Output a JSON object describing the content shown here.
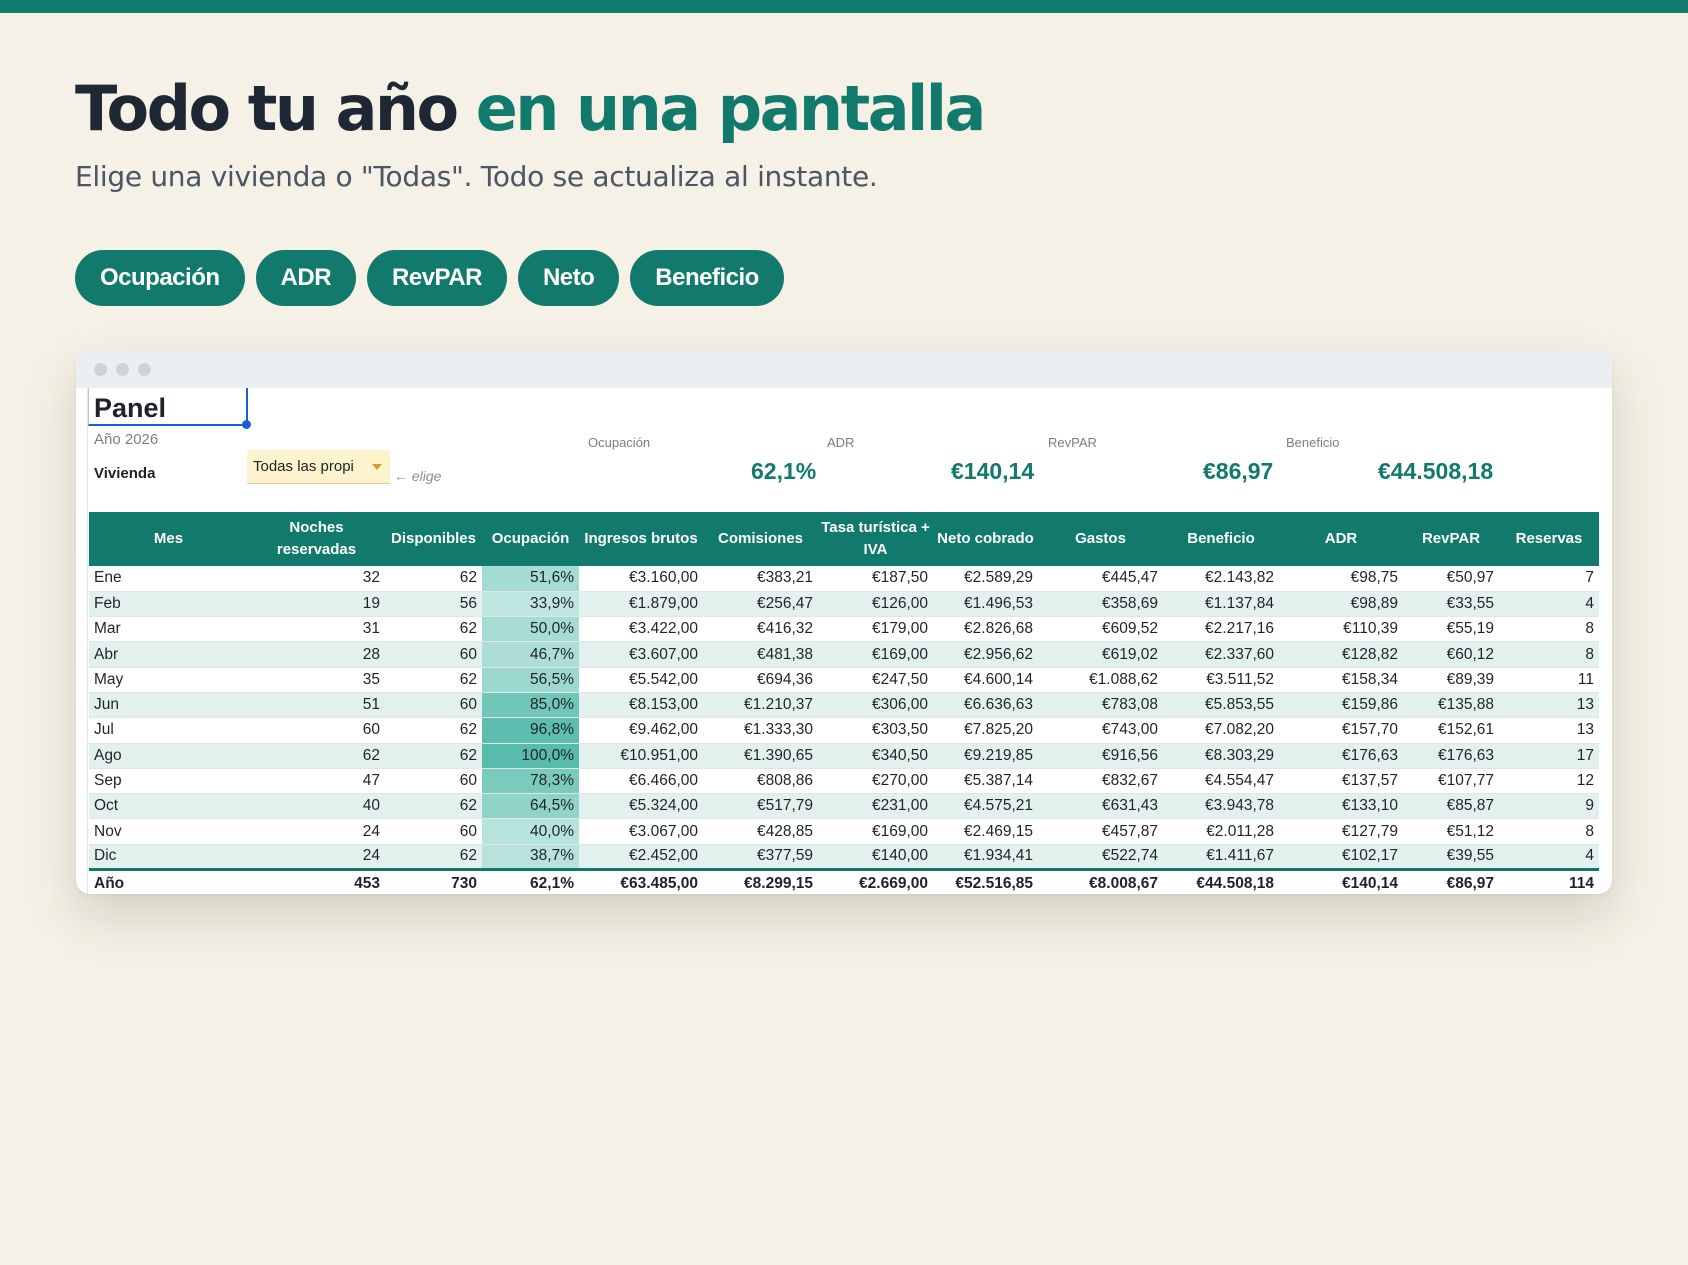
{
  "hero": {
    "title_main": "Todo tu año ",
    "title_accent": "en una pantalla",
    "subtitle": "Elige una vivienda o \"Todas\". Todo se actualiza al instante."
  },
  "pills": [
    "Ocupación",
    "ADR",
    "RevPAR",
    "Neto",
    "Beneficio"
  ],
  "sheet": {
    "panel_title": "Panel",
    "year": "Año 2026",
    "vivienda_label": "Vivienda",
    "vivienda_value": "Todas las propi",
    "elige_hint": "← elige",
    "kpis": [
      {
        "label": "Ocupación",
        "value": "62,1%"
      },
      {
        "label": "ADR",
        "value": "€140,14"
      },
      {
        "label": "RevPAR",
        "value": "€86,97"
      },
      {
        "label": "Beneficio",
        "value": "€44.508,18"
      }
    ],
    "columns": [
      "Mes",
      "Noches reservadas",
      "Disponibles",
      "Ocupación",
      "Ingresos brutos",
      "Comisiones",
      "Tasa turística + IVA",
      "Neto cobrado",
      "Gastos",
      "Beneficio",
      "ADR",
      "RevPAR",
      "Reservas"
    ],
    "occupancy": [
      51.6,
      33.9,
      50.0,
      46.7,
      56.5,
      85.0,
      96.8,
      100.0,
      78.3,
      64.5,
      40.0,
      38.7
    ],
    "rows": [
      [
        "Ene",
        "32",
        "62",
        "51,6%",
        "€3.160,00",
        "€383,21",
        "€187,50",
        "€2.589,29",
        "€445,47",
        "€2.143,82",
        "€98,75",
        "€50,97",
        "7"
      ],
      [
        "Feb",
        "19",
        "56",
        "33,9%",
        "€1.879,00",
        "€256,47",
        "€126,00",
        "€1.496,53",
        "€358,69",
        "€1.137,84",
        "€98,89",
        "€33,55",
        "4"
      ],
      [
        "Mar",
        "31",
        "62",
        "50,0%",
        "€3.422,00",
        "€416,32",
        "€179,00",
        "€2.826,68",
        "€609,52",
        "€2.217,16",
        "€110,39",
        "€55,19",
        "8"
      ],
      [
        "Abr",
        "28",
        "60",
        "46,7%",
        "€3.607,00",
        "€481,38",
        "€169,00",
        "€2.956,62",
        "€619,02",
        "€2.337,60",
        "€128,82",
        "€60,12",
        "8"
      ],
      [
        "May",
        "35",
        "62",
        "56,5%",
        "€5.542,00",
        "€694,36",
        "€247,50",
        "€4.600,14",
        "€1.088,62",
        "€3.511,52",
        "€158,34",
        "€89,39",
        "11"
      ],
      [
        "Jun",
        "51",
        "60",
        "85,0%",
        "€8.153,00",
        "€1.210,37",
        "€306,00",
        "€6.636,63",
        "€783,08",
        "€5.853,55",
        "€159,86",
        "€135,88",
        "13"
      ],
      [
        "Jul",
        "60",
        "62",
        "96,8%",
        "€9.462,00",
        "€1.333,30",
        "€303,50",
        "€7.825,20",
        "€743,00",
        "€7.082,20",
        "€157,70",
        "€152,61",
        "13"
      ],
      [
        "Ago",
        "62",
        "62",
        "100,0%",
        "€10.951,00",
        "€1.390,65",
        "€340,50",
        "€9.219,85",
        "€916,56",
        "€8.303,29",
        "€176,63",
        "€176,63",
        "17"
      ],
      [
        "Sep",
        "47",
        "60",
        "78,3%",
        "€6.466,00",
        "€808,86",
        "€270,00",
        "€5.387,14",
        "€832,67",
        "€4.554,47",
        "€137,57",
        "€107,77",
        "12"
      ],
      [
        "Oct",
        "40",
        "62",
        "64,5%",
        "€5.324,00",
        "€517,79",
        "€231,00",
        "€4.575,21",
        "€631,43",
        "€3.943,78",
        "€133,10",
        "€85,87",
        "9"
      ],
      [
        "Nov",
        "24",
        "60",
        "40,0%",
        "€3.067,00",
        "€428,85",
        "€169,00",
        "€2.469,15",
        "€457,87",
        "€2.011,28",
        "€127,79",
        "€51,12",
        "8"
      ],
      [
        "Dic",
        "24",
        "62",
        "38,7%",
        "€2.452,00",
        "€377,59",
        "€140,00",
        "€1.934,41",
        "€522,74",
        "€1.411,67",
        "€102,17",
        "€39,55",
        "4"
      ]
    ],
    "total": [
      "Año",
      "453",
      "730",
      "62,1%",
      "€63.485,00",
      "€8.299,15",
      "€2.669,00",
      "€52.516,85",
      "€8.008,67",
      "€44.508,18",
      "€140,14",
      "€86,97",
      "114"
    ]
  },
  "colors": {
    "accent": "#117a6c",
    "background": "#f5f1e6",
    "selector": "#fdf3cc"
  }
}
